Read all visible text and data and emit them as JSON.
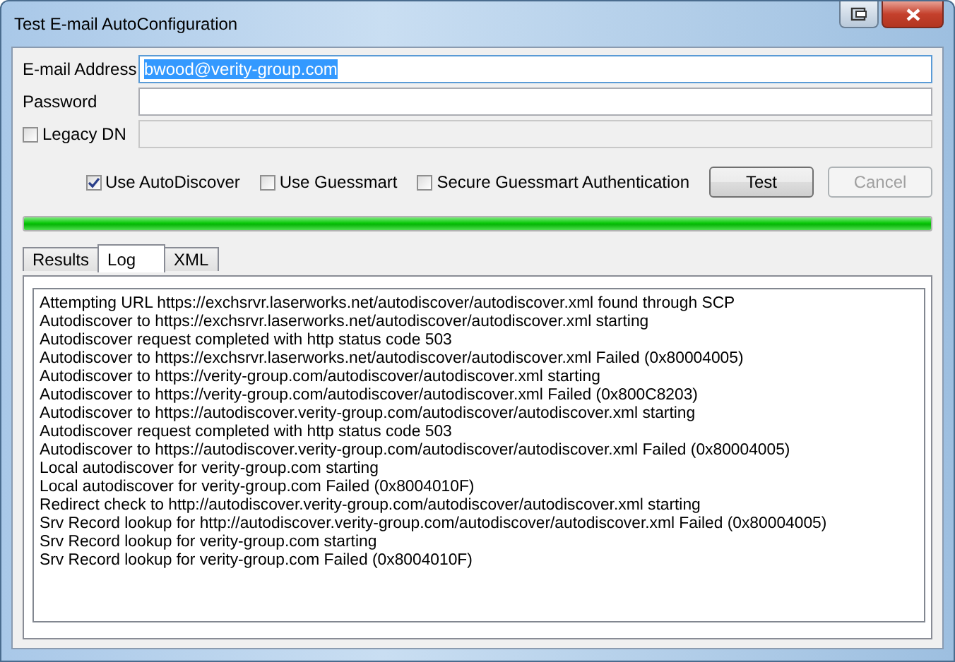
{
  "window": {
    "title": "Test E-mail AutoConfiguration"
  },
  "fields": [
    {
      "label": "E-mail Address",
      "value": "bwood@verity-group.com",
      "selected": true,
      "disabled": false
    },
    {
      "label": "Password",
      "disabled": false
    },
    {
      "label": "Legacy DN",
      "kind": "checkbox",
      "checked": false,
      "disabled": true
    }
  ],
  "options": [
    {
      "label": "Use AutoDiscover",
      "checked": true
    },
    {
      "label": "Use Guessmart",
      "checked": false
    },
    {
      "label": "Secure Guessmart Authentication",
      "checked": false
    }
  ],
  "buttons": [
    {
      "label": "Test",
      "disabled": false
    },
    {
      "label": "Cancel",
      "disabled": true
    }
  ],
  "progress": {
    "level": 1
  },
  "tabs": [
    {
      "label": "Results",
      "selected": false
    },
    {
      "label": "Log",
      "selected": true
    },
    {
      "label": "XML",
      "selected": false
    }
  ],
  "log": [
    "Attempting URL https://exchsrvr.laserworks.net/autodiscover/autodiscover.xml found through SCP",
    "Autodiscover to https://exchsrvr.laserworks.net/autodiscover/autodiscover.xml starting",
    "Autodiscover request completed with http status code 503",
    "Autodiscover to https://exchsrvr.laserworks.net/autodiscover/autodiscover.xml Failed (0x80004005)",
    "Autodiscover to https://verity-group.com/autodiscover/autodiscover.xml starting",
    "Autodiscover to https://verity-group.com/autodiscover/autodiscover.xml Failed (0x800C8203)",
    "Autodiscover to https://autodiscover.verity-group.com/autodiscover/autodiscover.xml starting",
    "Autodiscover request completed with http status code 503",
    "Autodiscover to https://autodiscover.verity-group.com/autodiscover/autodiscover.xml Failed (0x80004005)",
    "Local autodiscover for verity-group.com starting",
    "Local autodiscover for verity-group.com Failed (0x8004010F)",
    "Redirect check to http://autodiscover.verity-group.com/autodiscover/autodiscover.xml starting",
    "Srv Record lookup for http://autodiscover.verity-group.com/autodiscover/autodiscover.xml Failed (0x80004005)",
    "Srv Record lookup for verity-group.com starting",
    "Srv Record lookup for verity-group.com Failed (0x8004010F)"
  ]
}
